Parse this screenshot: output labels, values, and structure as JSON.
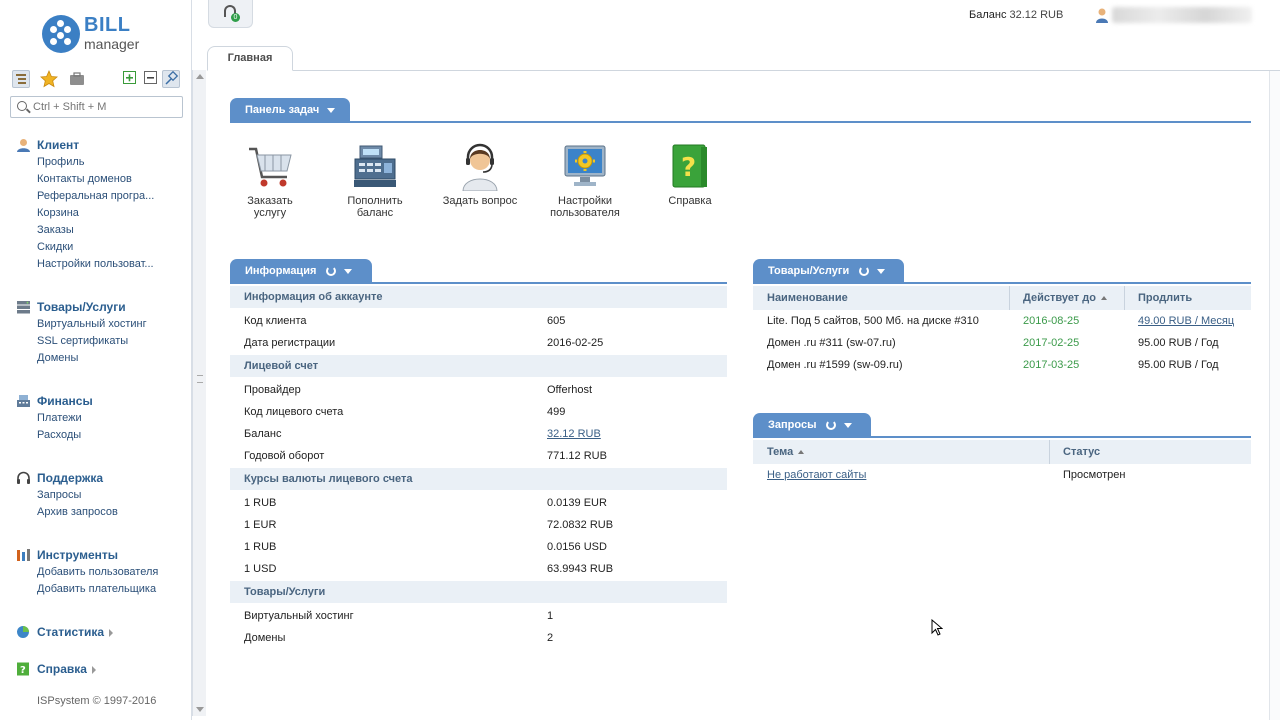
{
  "logo": {
    "brand_top": "BILL",
    "brand_bottom": "manager"
  },
  "sidebar": {
    "search_placeholder": "Ctrl + Shift + M",
    "groups": [
      {
        "label": "Клиент",
        "icon": "user-icon",
        "items": [
          "Профиль",
          "Контакты доменов",
          "Реферальная програ...",
          "Корзина",
          "Заказы",
          "Скидки",
          "Настройки пользоват..."
        ]
      },
      {
        "label": "Товары/Услуги",
        "icon": "server-icon",
        "items": [
          "Виртуальный хостинг",
          "SSL сертификаты",
          "Домены"
        ]
      },
      {
        "label": "Финансы",
        "icon": "cash-register-icon",
        "items": [
          "Платежи",
          "Расходы"
        ]
      },
      {
        "label": "Поддержка",
        "icon": "headset-icon",
        "items": [
          "Запросы",
          "Архив запросов"
        ]
      },
      {
        "label": "Инструменты",
        "icon": "tools-icon",
        "items": [
          "Добавить пользователя",
          "Добавить плательщика"
        ]
      },
      {
        "label": "Статистика",
        "icon": "pie-chart-icon",
        "items": []
      },
      {
        "label": "Справка",
        "icon": "help-book-icon",
        "items": []
      }
    ],
    "copyright": "ISPsystem © 1997-2016"
  },
  "topbar": {
    "balance_label": "Баланс",
    "balance_value": "32.12 RUB",
    "headset_badge": "0"
  },
  "tabs": {
    "main": "Главная"
  },
  "task_panel": {
    "title": "Панель задач",
    "items": [
      {
        "label_line1": "Заказать",
        "label_line2": "услугу",
        "icon": "shopping-cart-icon"
      },
      {
        "label_line1": "Пополнить",
        "label_line2": "баланс",
        "icon": "cash-register-icon"
      },
      {
        "label_line1": "Задать вопрос",
        "label_line2": "",
        "icon": "support-agent-icon"
      },
      {
        "label_line1": "Настройки",
        "label_line2": "пользователя",
        "icon": "settings-monitor-icon"
      },
      {
        "label_line1": "Справка",
        "label_line2": "",
        "icon": "help-book-icon"
      }
    ]
  },
  "info": {
    "title": "Информация",
    "groups": [
      {
        "title": "Информация об аккаунте",
        "rows": [
          [
            "Код клиента",
            "605"
          ],
          [
            "Дата регистрации",
            "2016-02-25"
          ]
        ]
      },
      {
        "title": "Лицевой счет",
        "rows": [
          [
            "Провайдер",
            "Offerhost"
          ],
          [
            "Код лицевого счета",
            "499"
          ],
          [
            "Баланс",
            "32.12 RUB"
          ],
          [
            "Годовой оборот",
            "771.12 RUB"
          ]
        ]
      },
      {
        "title": "Курсы валюты лицевого счета",
        "rows": [
          [
            "1 RUB",
            "0.0139 EUR"
          ],
          [
            "1 EUR",
            "72.0832 RUB"
          ],
          [
            "1 RUB",
            "0.0156 USD"
          ],
          [
            "1 USD",
            "63.9943 RUB"
          ]
        ]
      },
      {
        "title": "Товары/Услуги",
        "rows": [
          [
            "Виртуальный хостинг",
            "1"
          ],
          [
            "Домены",
            "2"
          ]
        ]
      }
    ]
  },
  "services": {
    "title": "Товары/Услуги",
    "columns": [
      "Наименование",
      "Действует до",
      "Продлить"
    ],
    "rows": [
      [
        "Lite. Под 5 сайтов, 500 Мб. на диске #310",
        "2016-08-25",
        "49.00 RUB / Месяц"
      ],
      [
        "Домен .ru #311 (sw-07.ru)",
        "2017-02-25",
        "95.00 RUB / Год"
      ],
      [
        "Домен .ru #1599 (sw-09.ru)",
        "2017-03-25",
        "95.00 RUB / Год"
      ]
    ]
  },
  "requests": {
    "title": "Запросы",
    "columns": [
      "Тема",
      "Статус"
    ],
    "rows": [
      [
        "Не работают сайты",
        "Просмотрен"
      ]
    ]
  }
}
